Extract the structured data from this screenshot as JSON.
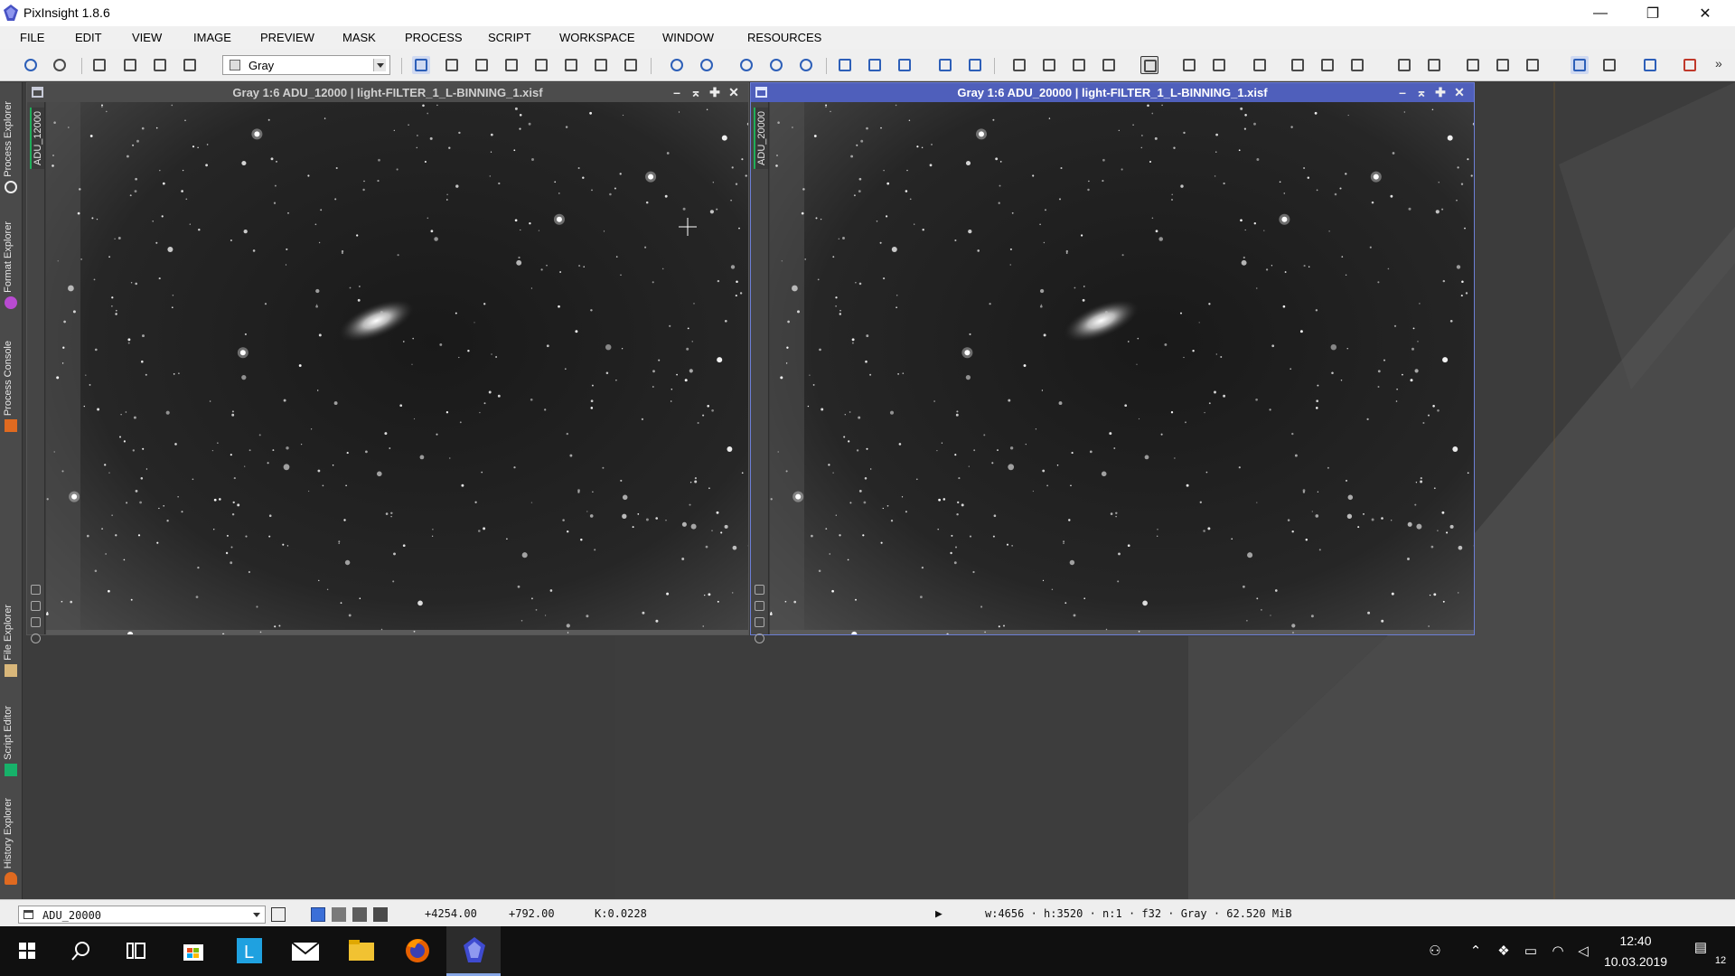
{
  "app": {
    "title": "PixInsight 1.8.6"
  },
  "window_controls": {
    "minimize": "—",
    "restore": "❐",
    "close": "✕"
  },
  "menu": [
    "FILE",
    "EDIT",
    "VIEW",
    "IMAGE",
    "PREVIEW",
    "MASK",
    "PROCESS",
    "SCRIPT",
    "WORKSPACE",
    "WINDOW",
    "RESOURCES"
  ],
  "toolbar": {
    "colorspace": "Gray",
    "overflow": "»"
  },
  "side_panels": [
    {
      "label": "Process Explorer",
      "icon": "gear-icon"
    },
    {
      "label": "Format Explorer",
      "icon": "purple-circle-icon"
    },
    {
      "label": "Process Console",
      "icon": "console-icon"
    },
    {
      "label": "File Explorer",
      "icon": "file-icon"
    },
    {
      "label": "Script Editor",
      "icon": "script-icon"
    },
    {
      "label": "History Explorer",
      "icon": "history-icon"
    }
  ],
  "image_windows": [
    {
      "title": "Gray 1:6 ADU_12000 | light-FILTER_1_L-BINNING_1.xisf",
      "view_id": "ADU_12000",
      "active": false
    },
    {
      "title": "Gray 1:6 ADU_20000 | light-FILTER_1_L-BINNING_1.xisf",
      "view_id": "ADU_20000",
      "active": true
    }
  ],
  "window_buttons": {
    "minimize": "–",
    "shade": "⌅",
    "maximize": "✚",
    "close": "✕"
  },
  "status": {
    "view": "ADU_20000",
    "x": "+4254.00",
    "y": "+792.00",
    "value": "K:0.0228",
    "info": "w:4656 · h:3520 · n:1 · f32 · Gray · 62.520 MiB"
  },
  "taskbar": {
    "time": "12:40",
    "date": "10.03.2019",
    "notifications": "12"
  },
  "colors": {
    "active_title": "#4f5fbb",
    "workspace": "#3b3b3b",
    "toolbar": "#efefef"
  }
}
